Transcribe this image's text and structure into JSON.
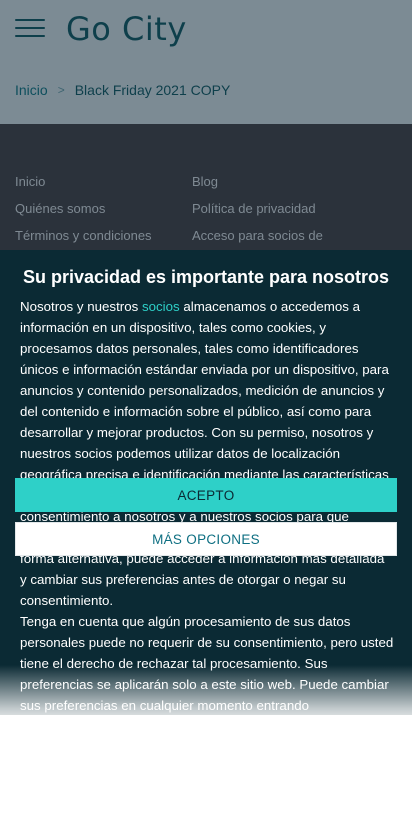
{
  "header": {
    "logo_text": "Go City",
    "menu_icon": "hamburger-menu-icon"
  },
  "breadcrumb": {
    "home": "Inicio",
    "separator": ">",
    "current": "Black Friday 2021 COPY"
  },
  "footer": {
    "links_left": [
      "Inicio",
      "Quiénes somos",
      "Términos y condiciones"
    ],
    "links_right": [
      "Blog",
      "Política de privacidad",
      "Acceso para socios de"
    ]
  },
  "consent": {
    "title": "Su privacidad es importante para nosotros",
    "intro_before_link": "Nosotros y nuestros ",
    "partners_link": "socios",
    "intro_after_link": " almacenamos o accedemos a información en un dispositivo, tales como cookies, y procesamos datos personales, tales como identificadores únicos e información estándar enviada por un dispositivo, para anuncios y contenido personalizados, medición de anuncios y del contenido e información sobre el público, así como para desarrollar y mejorar productos. Con su permiso, nosotros y nuestros socios podemos utilizar datos de localización geográfica precisa e identificación mediante las características de dispositivos. Puede hacer clic para otorgarnos su consentimiento a nosotros y a nuestros socios para que llevemos a cabo el procesamiento previamente descrito. De forma alternativa, puede acceder a información más detallada y cambiar sus preferencias antes de otorgar o negar su consentimiento.",
    "paragraph_2": "Tenga en cuenta que algún procesamiento de sus datos personales puede no requerir de su consentimiento, pero usted tiene el derecho de rechazar tal procesamiento. Sus preferencias se aplicarán solo a este sitio web. Puede cambiar sus preferencias en cualquier momento entrando",
    "accept_label": "ACEPTO",
    "more_options_label": "MÁS OPCIONES"
  },
  "colors": {
    "accent": "#2ed0c8",
    "dialog_bg": "#0b2a34",
    "brand": "#0e3f4b"
  }
}
